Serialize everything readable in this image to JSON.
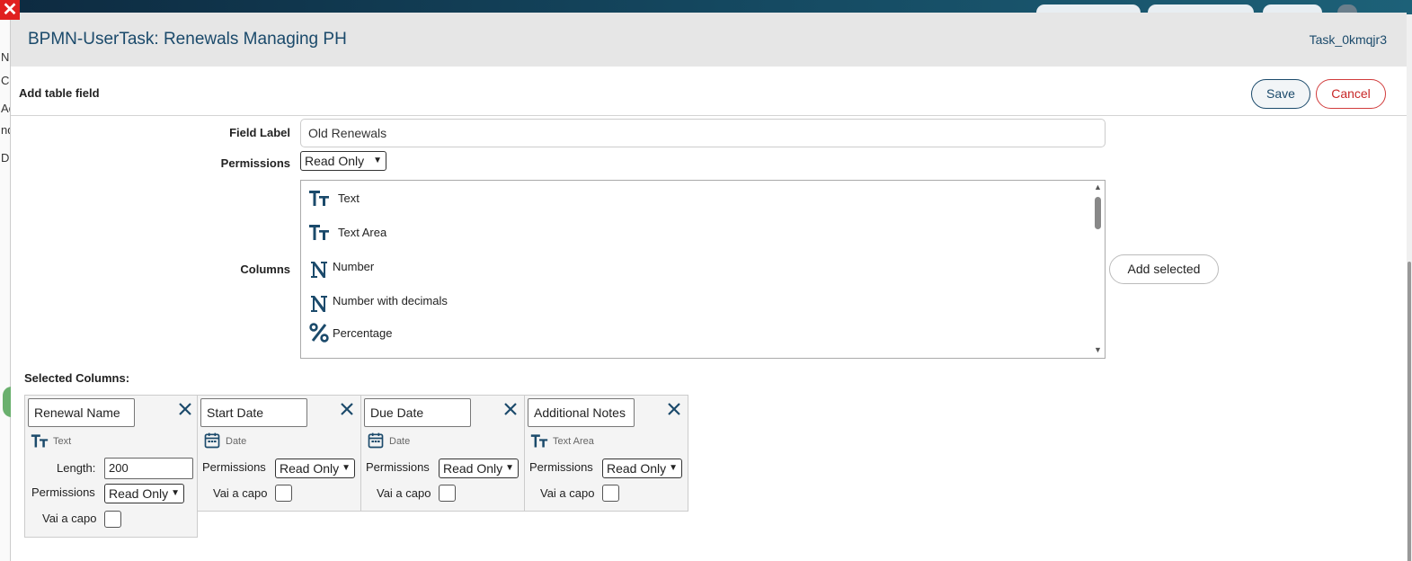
{
  "modal": {
    "title": "BPMN-UserTask: Renewals Managing PH",
    "task_id": "Task_0kmqjr3"
  },
  "background": {
    "left_fragments": [
      "N",
      "Co",
      "Ac",
      "nd",
      "D"
    ]
  },
  "panel": {
    "title": "Add table field",
    "save_label": "Save",
    "cancel_label": "Cancel"
  },
  "form": {
    "field_label_label": "Field Label",
    "field_label_value": "Old Renewals",
    "permissions_label": "Permissions",
    "permissions_value": "Read Only",
    "columns_label": "Columns",
    "add_selected_label": "Add selected"
  },
  "column_types": [
    {
      "label": "Text",
      "icon": "text-type-icon"
    },
    {
      "label": "Text Area",
      "icon": "text-type-icon"
    },
    {
      "label": "Number",
      "icon": "number-type-icon"
    },
    {
      "label": "Number with decimals",
      "icon": "number-type-icon"
    },
    {
      "label": "Percentage",
      "icon": "percentage-type-icon"
    }
  ],
  "selected_columns_title": "Selected Columns:",
  "selected_columns": [
    {
      "name": "Renewal Name",
      "type": "Text",
      "icon": "text-type-icon",
      "length_label": "Length:",
      "length": "200",
      "permissions_label": "Permissions",
      "permissions": "Read Only",
      "newline_label": "Vai a capo"
    },
    {
      "name": "Start Date",
      "type": "Date",
      "icon": "calendar-icon",
      "permissions_label": "Permissions",
      "permissions": "Read Only",
      "newline_label": "Vai a capo"
    },
    {
      "name": "Due Date",
      "type": "Date",
      "icon": "calendar-icon",
      "permissions_label": "Permissions",
      "permissions": "Read Only",
      "newline_label": "Vai a capo"
    },
    {
      "name": "Additional Notes",
      "type": "Text Area",
      "icon": "text-type-icon",
      "permissions_label": "Permissions",
      "permissions": "Read Only",
      "newline_label": "Vai a capo"
    }
  ],
  "colors": {
    "accent": "#1b4a6b",
    "cancel": "#c82828",
    "header_bg": "#e6e6e6"
  }
}
